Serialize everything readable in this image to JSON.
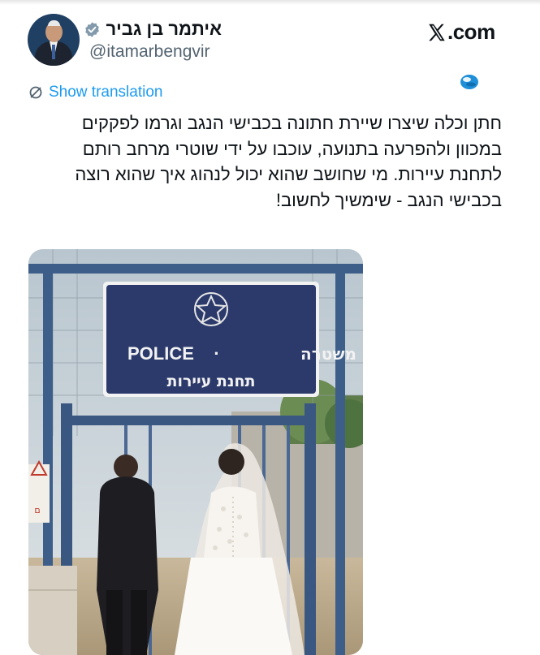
{
  "header": {
    "display_name": "איתמר בן גביר",
    "handle": "@itamarbengvir",
    "avatar_icon": "profile-photo",
    "verified_icon": "verified-badge-icon",
    "brand_domain": ".com",
    "brand_logo_icon": "x-logo-icon",
    "overlay_icon": "globe-orb-icon"
  },
  "translation": {
    "label": "Show translation",
    "icon": "translate-icon",
    "color": "#1d9bf0"
  },
  "tweet": {
    "lines": [
      "חתן וכלה שיצרו שיירת חתונה בכבישי הנגב וגרמו לפקקים",
      "במכוון ולהפרעה בתנועה, עוכבו על ידי שוטרי מרחב רותם",
      "לתחנת עיירות. מי שחושב שהוא יכול לנהוג איך שהוא רוצה",
      "בכבישי הנגב - שימשיך לחשוב!"
    ]
  },
  "media": {
    "sign_line1_en": "POLICE",
    "sign_separator": "·",
    "sign_line1_he": "משטרה",
    "sign_line2_he": "תחנת עיירות",
    "sign_emblem_icon": "police-star-emblem-icon",
    "side_sign_text": "ם"
  },
  "colors": {
    "text": "#0f1419",
    "secondary": "#536471",
    "verified": "#829aab",
    "sign_bg": "#2b3a6b"
  }
}
